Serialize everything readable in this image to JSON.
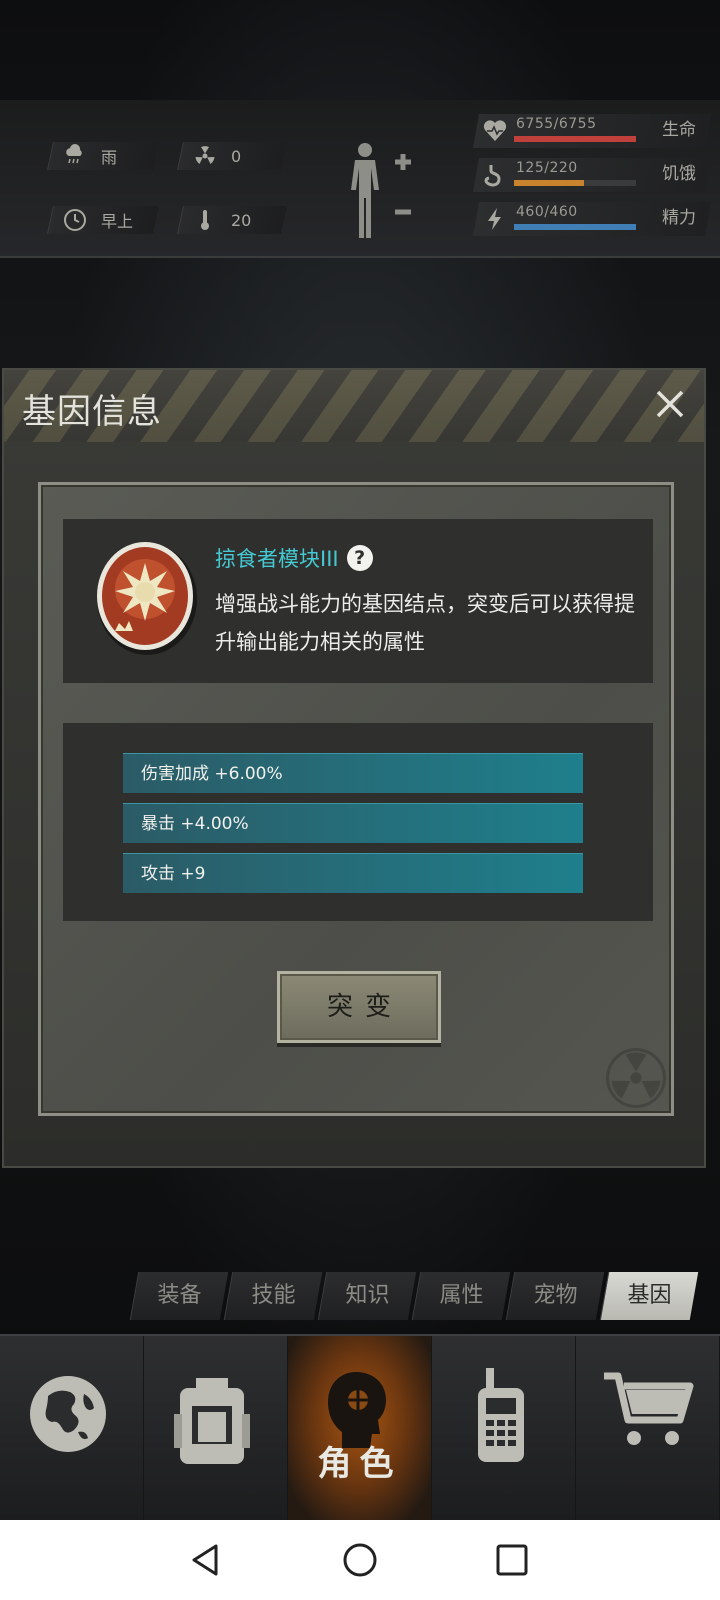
{
  "status": {
    "weather": "雨",
    "radiation": "0",
    "time": "早上",
    "temperature": "20",
    "stats": [
      {
        "name": "生命",
        "value": "6755/6755",
        "fraction": 1.0,
        "color": "#c0413b"
      },
      {
        "name": "饥饿",
        "value": "125/220",
        "fraction": 0.57,
        "color": "#c9832c"
      },
      {
        "name": "精力",
        "value": "460/460",
        "fraction": 1.0,
        "color": "#3f7fb6"
      }
    ]
  },
  "dialog": {
    "title": "基因信息",
    "gene_name": "掠食者模块III",
    "help_glyph": "?",
    "description": "增强战斗能力的基因结点，突变后可以获得提升输出能力相关的属性",
    "bonuses": [
      "伤害加成 +6.00%",
      "暴击 +4.00%",
      "攻击 +9"
    ],
    "mutate_label": "突变"
  },
  "tabs": [
    "装备",
    "技能",
    "知识",
    "属性",
    "宠物",
    "基因"
  ],
  "active_tab": "基因",
  "nav": {
    "items": [
      "world-map-icon",
      "backpack-icon",
      "character-icon",
      "walkie-talkie-icon",
      "shopping-cart-icon"
    ],
    "active_label": "角色"
  }
}
